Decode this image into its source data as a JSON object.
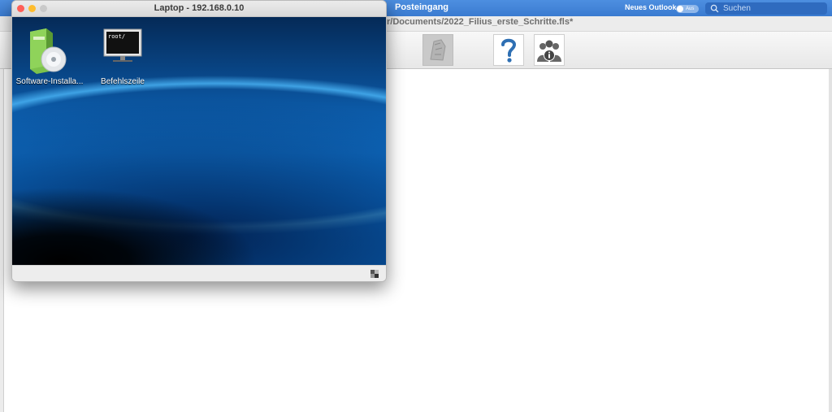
{
  "outlook": {
    "title": "Posteingang",
    "neues_outlook_label": "Neues Outlook",
    "toggle_label": "Aus",
    "search_placeholder": "Suchen"
  },
  "filius": {
    "path": "r/Documents/2022_Filius_erste_Schritte.fls*",
    "toolbar_icons": [
      "network-icon",
      "help-icon",
      "info-icon"
    ]
  },
  "laptop_window": {
    "title": "Laptop - 192.168.0.10",
    "desktop_icons": [
      {
        "label": "Software-Installa...",
        "icon": "software-install-icon"
      },
      {
        "label": "Befehlszeile",
        "icon": "terminal-icon"
      }
    ],
    "terminal_screen_text": "root/"
  }
}
